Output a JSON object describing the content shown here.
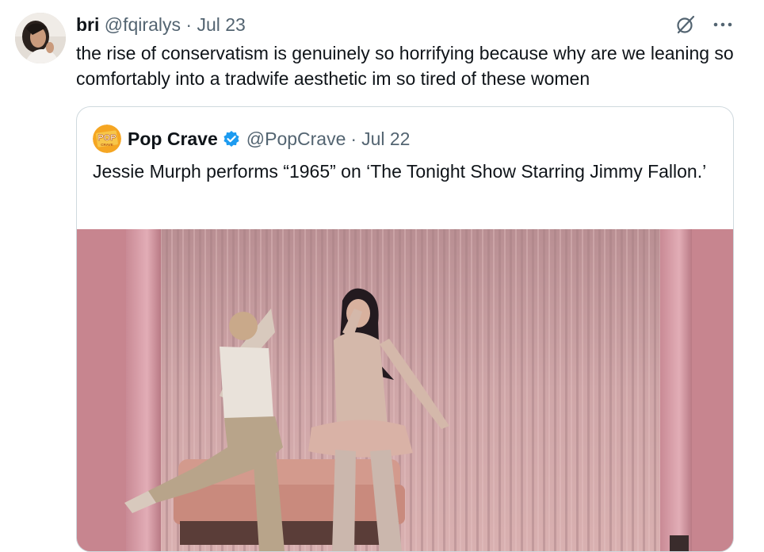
{
  "post": {
    "author_name": "bri",
    "author_handle": "@fqiralys",
    "separator": "·",
    "date": "Jul 23",
    "text": "the rise of conservatism is genuinely so horrifying because why are we leaning so comfortably into a tradwife aesthetic im so tired of these women"
  },
  "quoted_post": {
    "author_name": "Pop Crave",
    "author_handle": "@PopCrave",
    "separator": "·",
    "date": "Jul 22",
    "text": "Jessie Murph performs “1965” on ‘The Tonight Show Starring Jimmy Fallon.’",
    "avatar_logo_text_top": "POP",
    "avatar_logo_text_bottom": "CRAVE"
  },
  "icons": {
    "grok": "grok-icon",
    "more": "more-icon",
    "verified": "verified-badge-icon"
  },
  "colors": {
    "text_primary": "#0f1419",
    "text_secondary": "#536471",
    "verified_blue": "#1d9bf0",
    "border": "#cfd9de",
    "popcrave_orange": "#f5a623"
  }
}
